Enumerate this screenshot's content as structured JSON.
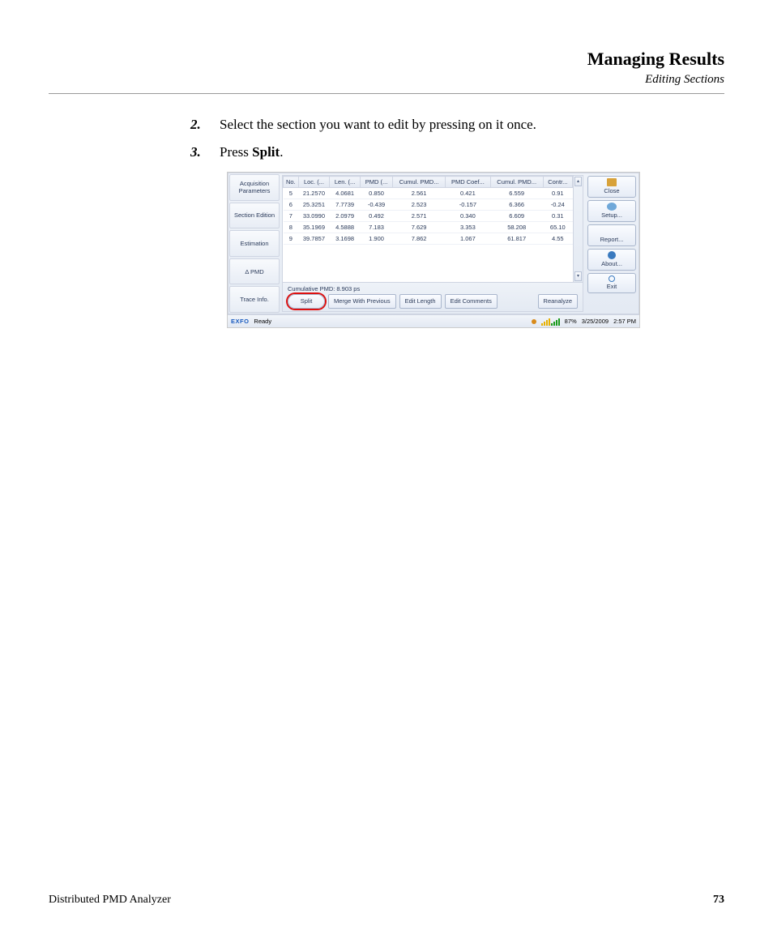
{
  "header": {
    "chapter": "Managing Results",
    "section": "Editing Sections"
  },
  "steps": [
    {
      "num": "2.",
      "text": "Select the section you want to edit by pressing on it once."
    },
    {
      "num": "3.",
      "prefix": "Press ",
      "bold": "Split",
      "suffix": "."
    }
  ],
  "screenshot": {
    "left_tabs": [
      "Acquisition Parameters",
      "Section Edition",
      "Estimation",
      "Δ PMD",
      "Trace Info."
    ],
    "table": {
      "headers": [
        "No.",
        "Loc. (...",
        "Len. (...",
        "PMD (...",
        "Cumul. PMD...",
        "PMD Coef...",
        "Cumul. PMD...",
        "Contr..."
      ],
      "rows": [
        [
          "5",
          "21.2570",
          "4.0681",
          "0.850",
          "2.561",
          "0.421",
          "6.559",
          "0.91"
        ],
        [
          "6",
          "25.3251",
          "7.7739",
          "-0.439",
          "2.523",
          "-0.157",
          "6.366",
          "-0.24"
        ],
        [
          "7",
          "33.0990",
          "2.0979",
          "0.492",
          "2.571",
          "0.340",
          "6.609",
          "0.31"
        ],
        [
          "8",
          "35.1969",
          "4.5888",
          "7.183",
          "7.629",
          "3.353",
          "58.208",
          "65.10"
        ],
        [
          "9",
          "39.7857",
          "3.1698",
          "1.900",
          "7.862",
          "1.067",
          "61.817",
          "4.55"
        ]
      ]
    },
    "under_label": "Cumulative PMD: 8.903 ps",
    "action_buttons": [
      "Split",
      "Merge With Previous",
      "Edit Length",
      "Edit Comments"
    ],
    "reanalyze": "Reanalyze",
    "side_buttons": [
      {
        "label": "Close",
        "icon": "folder"
      },
      {
        "label": "Setup...",
        "icon": "gear"
      },
      {
        "label": "Report...",
        "icon": "none"
      },
      {
        "label": "About...",
        "icon": "help"
      },
      {
        "label": "Exit",
        "icon": "power"
      }
    ],
    "status": {
      "brand": "EXFO",
      "ready": "Ready",
      "percent": "87%",
      "date": "3/25/2009",
      "time": "2:57 PM"
    }
  },
  "footer": {
    "product": "Distributed PMD Analyzer",
    "page": "73"
  }
}
